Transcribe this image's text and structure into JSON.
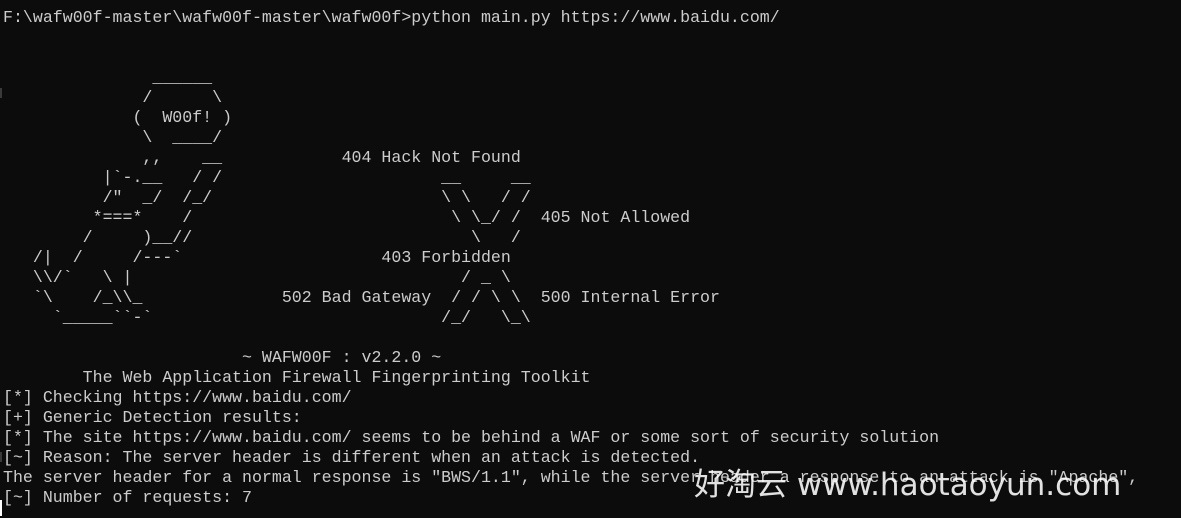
{
  "window": {
    "background_color": "#0c0c0c",
    "text_color": "#cccccc"
  },
  "console": {
    "lines": [
      "F:\\wafw00f-master\\wafw00f-master\\wafw00f>python main.py https://www.baidu.com/",
      "",
      "",
      "               ______",
      "              /      \\",
      "             (  W00f! )",
      "              \\  ____/",
      "              ,,    __            404 Hack Not Found",
      "          |`-.__   / /                      __     __",
      "          /\"  _/  /_/                       \\ \\   / /",
      "         *===*    /                          \\ \\_/ /  405 Not Allowed",
      "        /     )__//                            \\   /",
      "   /|  /     /---`                    403 Forbidden",
      "   \\\\/`   \\ |                                 / _ \\",
      "   `\\    /_\\\\_              502 Bad Gateway  / / \\ \\  500 Internal Error",
      "     `_____``-`                             /_/   \\_\\",
      "",
      "                        ~ WAFW00F : v2.2.0 ~",
      "        The Web Application Firewall Fingerprinting Toolkit",
      "",
      "[*] Checking https://www.baidu.com/",
      "[+] Generic Detection results:",
      "[*] The site https://www.baidu.com/ seems to be behind a WAF or some sort of security solution",
      "[~] Reason: The server header is different when an attack is detected.",
      "The server header for a normal response is \"BWS/1.1\", while the server header a response to an attack is \"Apache\",",
      "[~] Number of requests: 7"
    ]
  },
  "watermark": {
    "text": "好淘云 www.haotaoyun.com"
  }
}
